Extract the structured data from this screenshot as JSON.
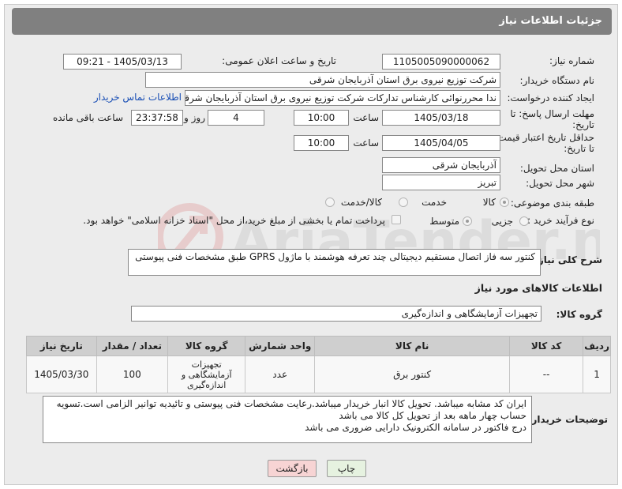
{
  "header": {
    "title": "جزئیات اطلاعات نیاز"
  },
  "labels": {
    "need_number": "شماره نیاز:",
    "announce_datetime": "تاریخ و ساعت اعلان عمومی:",
    "buyer_org": "نام دستگاه خریدار:",
    "requester": "ایجاد کننده درخواست:",
    "reply_deadline_1": "مهلت ارسال پاسخ: تا",
    "reply_deadline_2": "تاریخ:",
    "price_validity_1": "حداقل تاریخ اعتبار قیمت:",
    "price_validity_2": "تا تاریخ:",
    "time": "ساعت",
    "days_and": "روز و",
    "hours_left": "ساعت باقی مانده",
    "delivery_province": "استان محل تحویل:",
    "delivery_city": "شهر محل تحویل:",
    "category": "طبقه بندی موضوعی:",
    "purchase_type": "نوع فرآیند خرید :",
    "description": "شرح کلی نیاز:",
    "goods_info": "اطلاعات کالاهای مورد نیاز",
    "goods_group": "گروه کالا:",
    "buyer_notes": "توضیحات خریدار:"
  },
  "fields": {
    "need_number": "1105005090000062",
    "announce_datetime": "1405/03/13 - 09:21",
    "buyer_org": "شرکت توزیع نیروی برق استان آذربایجان شرقی",
    "requester": "ندا محررنوائی کارشناس تدارکات شرکت توزیع نیروی برق استان آذربایجان شرقی",
    "contact_link": "اطلاعات تماس خریدار",
    "reply_date": "1405/03/18",
    "reply_time": "10:00",
    "days": "4",
    "remaining": "23:37:58",
    "validity_date": "1405/04/05",
    "validity_time": "10:00",
    "province": "آذربایجان شرقی",
    "city": "تبریز",
    "description": "کنتور سه فاز اتصال مستقیم دیجیتالی چند تعرفه هوشمند با ماژول GPRS طبق مشخصات فنی پیوستی",
    "goods_group": "تجهیزات آزمایشگاهی و اندازه‌گیری"
  },
  "category_options": [
    "کالا",
    "خدمت",
    "کالا/خدمت"
  ],
  "category_selected": "کالا",
  "purchase_options": [
    "جزیی",
    "متوسط"
  ],
  "purchase_selected": "متوسط",
  "payment_note": "پرداخت تمام یا بخشی از مبلغ خرید،از محل \"اسناد خزانه اسلامی\" خواهد بود.",
  "table": {
    "headers": [
      "ردیف",
      "کد کالا",
      "نام کالا",
      "واحد شمارش",
      "گروه کالا",
      "تعداد / مقدار",
      "تاریخ نیاز"
    ],
    "rows": [
      [
        "1",
        "--",
        "کنتور برق",
        "عدد",
        "تجهیزات آزمایشگاهی و اندازه‌گیری",
        "100",
        "1405/03/30"
      ]
    ]
  },
  "buyer_notes": [
    "ایران کد مشابه میباشد. تحویل کالا انبار خریدار میباشد.رعایت مشخصات فنی پیوستی و تائیدیه توانیر الزامی است.تسویه حساب چهار ماهه بعد از تحویل کل کالا می باشد",
    "درج فاکتور در سامانه الکترونیک دارایی ضروری می باشد"
  ],
  "buttons": {
    "print": "چاپ",
    "back": "بازگشت"
  },
  "watermark": "AriaTender.net",
  "colors": {
    "header_bg": "#808080",
    "back_btn": "#f7d4d4",
    "print_btn": "#e6f2e0",
    "link": "#1a4fb5"
  }
}
